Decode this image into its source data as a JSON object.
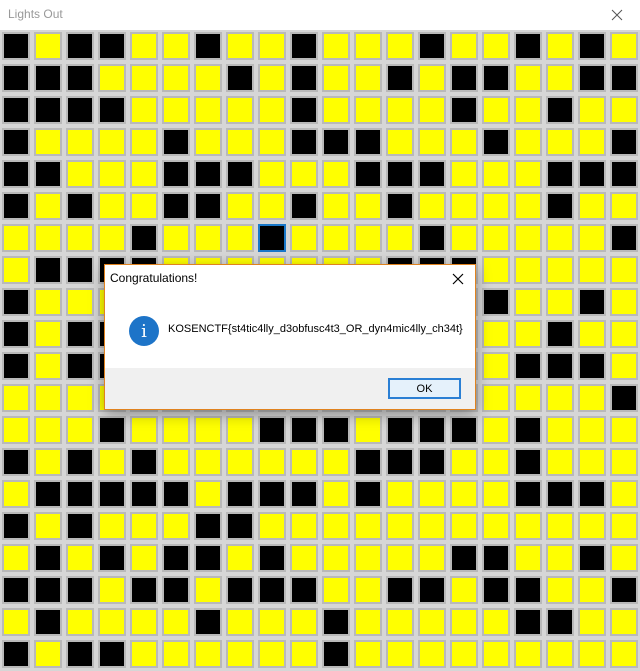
{
  "window": {
    "title": "Lights Out",
    "close_icon": "close-icon"
  },
  "board": {
    "colors": {
      "on": "#ffff00",
      "off": "#000000",
      "frame": "#b9b9b9",
      "focus": "#1a78c8"
    },
    "focused": {
      "row": 6,
      "col": 8
    },
    "rows": [
      "010011011011101101011",
      "000111101011010011000",
      "000011111011110110110",
      "011110111000111011101",
      "001110001110001110001",
      "010110011011011110111",
      "111101110111101111101",
      "100001111111000111110",
      "011111011111111011011",
      "010000001110000110110",
      "010000011110111100011",
      "111111111111110111101",
      "111011110001000101111",
      "010101111110001101111",
      "100000100010111100011",
      "010111001111111111111",
      "101010010111110011011",
      "000100100011001001101",
      "101111011101111100111",
      "010011111101111111111"
    ]
  },
  "dialog": {
    "title": "Congratulations!",
    "message": "KOSENCTF{st4tic4lly_d3obfusc4t3_OR_dyn4mic4lly_ch34t}",
    "ok_label": "OK",
    "icon": "info-icon",
    "icon_glyph": "i",
    "accent": "#1d74c8"
  }
}
